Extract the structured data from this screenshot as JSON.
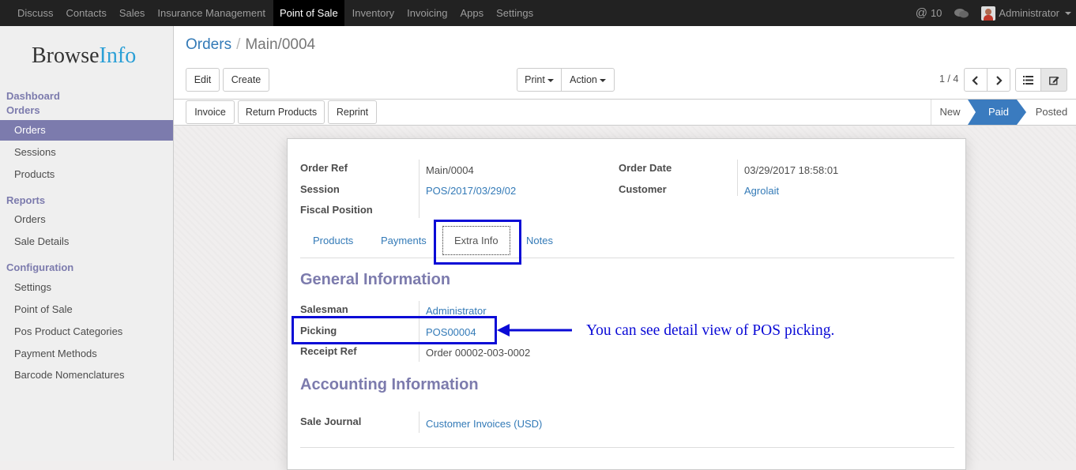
{
  "topnav": {
    "items": [
      "Discuss",
      "Contacts",
      "Sales",
      "Insurance Management",
      "Point of Sale",
      "Inventory",
      "Invoicing",
      "Apps",
      "Settings"
    ],
    "active_index": 4,
    "notifications_count": "10",
    "user": "Administrator"
  },
  "sidebar": {
    "logo_browse": "Browse",
    "logo_info": "Info",
    "sections": [
      {
        "title": "Dashboard",
        "items": []
      },
      {
        "title": "Orders",
        "items": [
          "Orders",
          "Sessions",
          "Products"
        ]
      },
      {
        "title": "Reports",
        "items": [
          "Orders",
          "Sale Details"
        ]
      },
      {
        "title": "Configuration",
        "items": [
          "Settings",
          "Point of Sale",
          "Pos Product Categories",
          "Payment Methods",
          "Barcode Nomenclatures"
        ]
      }
    ],
    "active_item": "Orders"
  },
  "control_panel": {
    "breadcrumb_parent": "Orders",
    "breadcrumb_separator": "/",
    "breadcrumb_current": "Main/0004",
    "edit_label": "Edit",
    "create_label": "Create",
    "print_label": "Print",
    "action_label": "Action",
    "pager": "1 / 4"
  },
  "statusbar": {
    "buttons": [
      "Invoice",
      "Return Products",
      "Reprint"
    ],
    "stages": [
      "New",
      "Paid",
      "Posted"
    ],
    "current_stage": "Paid"
  },
  "form": {
    "order_ref_label": "Order Ref",
    "order_ref": "Main/0004",
    "session_label": "Session",
    "session": "POS/2017/03/29/02",
    "fiscal_position_label": "Fiscal Position",
    "order_date_label": "Order Date",
    "order_date": "03/29/2017 18:58:01",
    "customer_label": "Customer",
    "customer": "Agrolait",
    "tabs": [
      "Products",
      "Payments",
      "Extra Info",
      "Notes"
    ],
    "active_tab": "Extra Info",
    "general_title": "General Information",
    "salesman_label": "Salesman",
    "salesman": "Administrator",
    "picking_label": "Picking",
    "picking": "POS00004",
    "receipt_ref_label": "Receipt Ref",
    "receipt_ref": "Order 00002-003-0002",
    "accounting_title": "Accounting Information",
    "sale_journal_label": "Sale Journal",
    "sale_journal": "Customer Invoices (USD)"
  },
  "annotation": {
    "text": "You can see detail view of POS picking.",
    "color": "#0a0ad6"
  },
  "colors": {
    "accent": "#7c7bad",
    "link": "#337ab7",
    "status_active": "#3a7bbf"
  }
}
